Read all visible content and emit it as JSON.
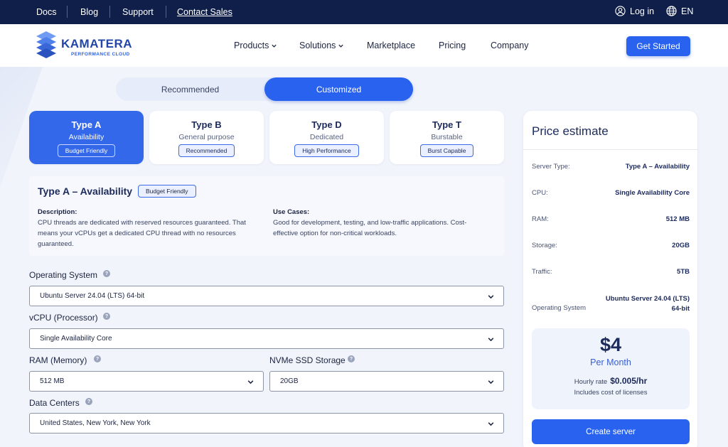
{
  "topbar": {
    "docs": "Docs",
    "blog": "Blog",
    "support": "Support",
    "contact_sales": "Contact Sales",
    "login": "Log in",
    "language": "EN"
  },
  "nav": {
    "brand": "KAMATERA",
    "tagline": "PERFORMANCE CLOUD",
    "products": "Products",
    "solutions": "Solutions",
    "marketplace": "Marketplace",
    "pricing": "Pricing",
    "company": "Company",
    "get_started": "Get Started"
  },
  "toggle": {
    "recommended": "Recommended",
    "customized": "Customized",
    "active": "customized"
  },
  "types": [
    {
      "name": "Type A",
      "sub": "Availability",
      "badge": "Budget Friendly",
      "active": true
    },
    {
      "name": "Type B",
      "sub": "General purpose",
      "badge": "Recommended",
      "active": false
    },
    {
      "name": "Type D",
      "sub": "Dedicated",
      "badge": "High Performance",
      "active": false
    },
    {
      "name": "Type T",
      "sub": "Burstable",
      "badge": "Burst Capable",
      "active": false
    }
  ],
  "detail": {
    "title": "Type A – Availability",
    "badge": "Budget Friendly",
    "desc_label": "Description:",
    "desc_l1": "CPU threads are dedicated with reserved resources guaranteed. That",
    "desc_l2": "means your vCPUs get a dedicated CPU thread with no resources",
    "desc_l3": "guaranteed.",
    "use_label": "Use Cases:",
    "use_l1": "Good for development, testing, and low-traffic applications. Cost-",
    "use_l2": "effective option for non-critical workloads."
  },
  "form": {
    "os_label": "Operating System",
    "os_value": "Ubuntu Server 24.04 (LTS) 64-bit",
    "cpu_label": "vCPU (Processor)",
    "cpu_value": "Single Availability Core",
    "ram_label": "RAM (Memory)",
    "ram_value": "512 MB",
    "storage_label": "NVMe SSD Storage",
    "storage_value": "20GB",
    "dc_label": "Data Centers",
    "dc_value": "United States, New York, New York",
    "help": "?"
  },
  "price": {
    "title": "Price estimate",
    "server_type_k": "Server Type:",
    "server_type_v": "Type A – Availability",
    "cpu_k": "CPU:",
    "cpu_v": "Single Availability Core",
    "ram_k": "RAM:",
    "ram_v": "512 MB",
    "storage_k": "Storage:",
    "storage_v": "20GB",
    "traffic_k": "Traffic:",
    "traffic_v": "5TB",
    "os_k": "Operating System",
    "os_v1": "Ubuntu Server 24.04 (LTS)",
    "os_v2": "64-bit",
    "amount": "$4",
    "period": "Per Month",
    "hourly_label": "Hourly rate",
    "hourly_value": "$0.005/hr",
    "licenses": "Includes cost of licenses",
    "create": "Create server"
  },
  "colors": {
    "topbar": "#0f1f4a",
    "accent": "#2962ef",
    "brand": "#2345a8"
  }
}
